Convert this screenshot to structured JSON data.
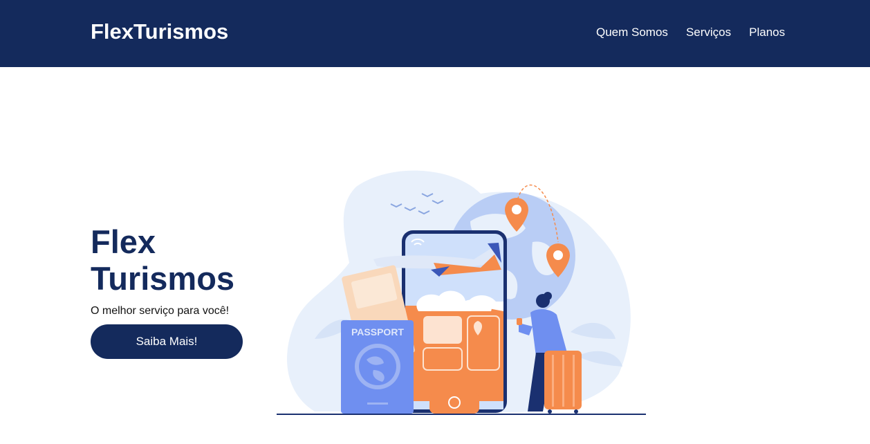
{
  "brand": "FlexTurismos",
  "nav": {
    "items": [
      {
        "label": "Quem Somos"
      },
      {
        "label": "Serviços"
      },
      {
        "label": "Planos"
      }
    ]
  },
  "hero": {
    "title_line1": "Flex",
    "title_line2": "Turismos",
    "subtitle": "O melhor serviço para você!",
    "cta_label": "Saiba Mais!"
  },
  "illustration": {
    "passport_label": "PASSPORT"
  },
  "colors": {
    "navy": "#142a5c",
    "orange": "#f58b4c",
    "blue": "#6f8ff0",
    "light_blue": "#e6eefb"
  }
}
